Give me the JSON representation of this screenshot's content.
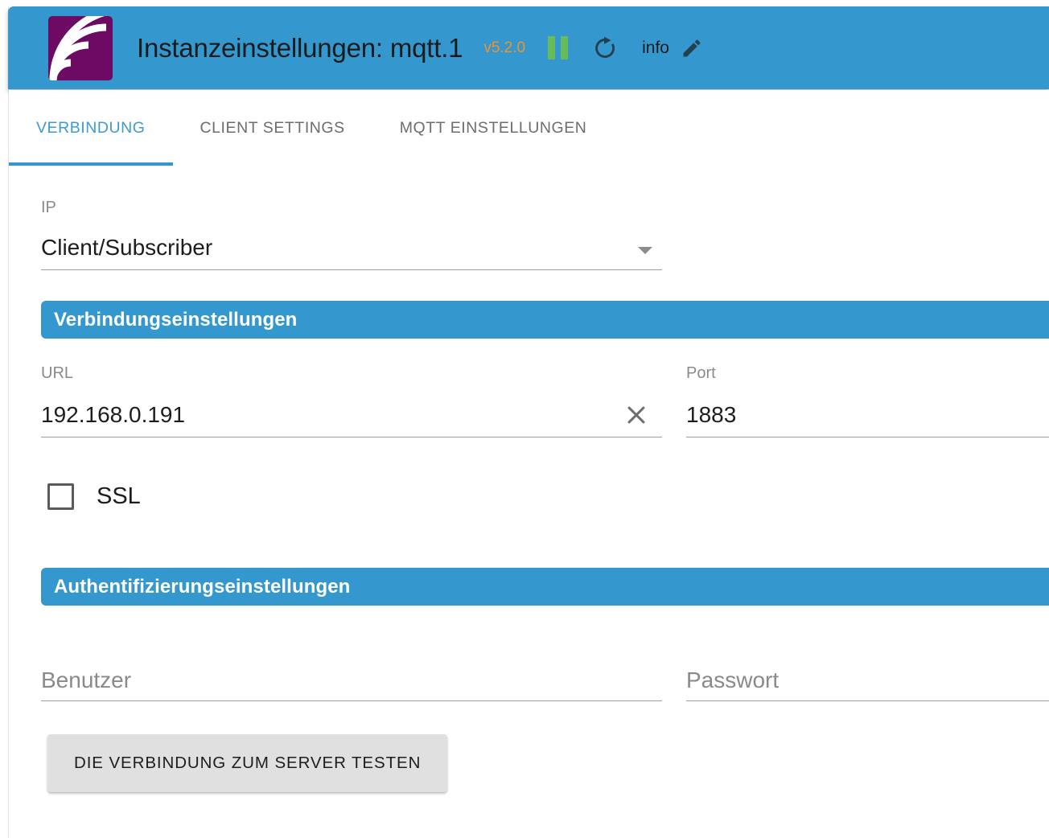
{
  "header": {
    "logo_icon": "mqtt-waves-logo-icon",
    "title": "Instanzeinstellungen: mqtt.1",
    "version": "v5.2.0",
    "pause_icon": "pause-icon",
    "refresh_icon": "refresh-icon",
    "info_label": "info",
    "edit_icon": "pencil-edit-icon",
    "bar_color": "#3498cf",
    "version_color": "#f0922b",
    "pause_color": "#68bb59",
    "logo_color": "#6d0a63"
  },
  "tabs": [
    {
      "label": "VERBINDUNG",
      "active": true
    },
    {
      "label": "CLIENT SETTINGS",
      "active": false
    },
    {
      "label": "MQTT EINSTELLUNGEN",
      "active": false
    }
  ],
  "form": {
    "ip": {
      "label": "IP",
      "value": "Client/Subscriber",
      "dropdown_icon": "chevron-down-icon"
    },
    "section_connection": {
      "title": "Verbindungseinstellungen"
    },
    "url": {
      "label": "URL",
      "value": "192.168.0.191",
      "clear_icon": "close-icon"
    },
    "port": {
      "label": "Port",
      "value": "1883"
    },
    "ssl": {
      "label": "SSL",
      "checked": false
    },
    "section_auth": {
      "title": "Authentifizierungseinstellungen"
    },
    "user": {
      "label": "",
      "value": "",
      "placeholder": "Benutzer"
    },
    "password": {
      "label": "",
      "value": "",
      "placeholder": "Passwort"
    },
    "test_button": {
      "label": "DIE VERBINDUNG ZUM SERVER TESTEN"
    }
  }
}
